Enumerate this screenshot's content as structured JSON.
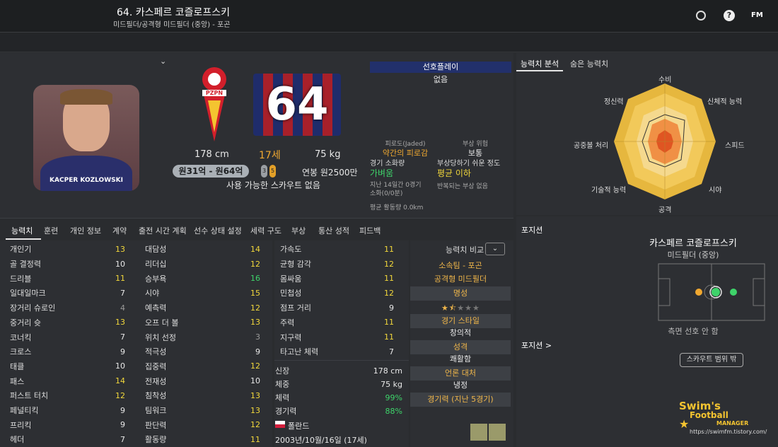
{
  "header": {
    "title": "64. 카스페르 코즐로프스키",
    "subtitle": "미드필더/공격형 미드필더 (중앙) - 포곤",
    "fm_label": "FM"
  },
  "player": {
    "photo_caption": "KACPER KOZLOWSKI",
    "crest_text": "PZPN",
    "shirt_number": "64",
    "height": "178 cm",
    "age": "17세",
    "weight": "75 kg",
    "value_range": "원31억 - 원64억",
    "ability_stars": [
      "3",
      "5"
    ],
    "wage": "연봉 원2500만",
    "scout_note": "사용 가능한 스카우트 없음"
  },
  "preferred": {
    "header": "선호플레이",
    "value": "없음"
  },
  "fitness": {
    "fatigue_label": "피로도(Jaded)",
    "fatigue_value": "약간의 피로감",
    "injury_label": "부상 위험",
    "injury_value": "보통",
    "match_load_label": "경기 소화량",
    "match_load_value": "가벼움",
    "proneness_label": "부상당하기 쉬운 정도",
    "proneness_value": "평균 이하",
    "recent_label": "지난 14일간 0경기 소화(0/0분)",
    "recurring_label": "반복되는 부상 없음",
    "avg_distance": "평균 활동량 0.0km"
  },
  "radar": {
    "tabs": [
      "능력치 분석",
      "숨은 능력치"
    ],
    "labels": [
      "수비",
      "신체적 능력",
      "스피드",
      "시야",
      "공격",
      "기술적 능력",
      "공중볼 처리",
      "정신력"
    ]
  },
  "tabs": [
    "능력치",
    "훈련",
    "개인 정보",
    "계약",
    "출전 시간 계획",
    "선수 상태 설정",
    "세력 구도",
    "부상",
    "통산 성적",
    "피드백"
  ],
  "technical": [
    {
      "name": "개인기",
      "value": "13",
      "c": "yellow"
    },
    {
      "name": "골 결정력",
      "value": "10",
      "c": "white"
    },
    {
      "name": "드리블",
      "value": "11",
      "c": "yellow"
    },
    {
      "name": "일대일마크",
      "value": "7",
      "c": "white"
    },
    {
      "name": "장거리 슈로인",
      "value": "4",
      "c": "grey"
    },
    {
      "name": "중거리 슛",
      "value": "13",
      "c": "yellow"
    },
    {
      "name": "코너킥",
      "value": "7",
      "c": "white"
    },
    {
      "name": "크로스",
      "value": "9",
      "c": "white"
    },
    {
      "name": "태클",
      "value": "10",
      "c": "white"
    },
    {
      "name": "패스",
      "value": "14",
      "c": "yellow"
    },
    {
      "name": "퍼스트 터치",
      "value": "12",
      "c": "yellow"
    },
    {
      "name": "페널티킥",
      "value": "9",
      "c": "white"
    },
    {
      "name": "프리킥",
      "value": "9",
      "c": "white"
    },
    {
      "name": "헤더",
      "value": "7",
      "c": "white"
    }
  ],
  "mental": [
    {
      "name": "대담성",
      "value": "14",
      "c": "yellow"
    },
    {
      "name": "리더십",
      "value": "12",
      "c": "yellow"
    },
    {
      "name": "승부욕",
      "value": "16",
      "c": "green"
    },
    {
      "name": "시야",
      "value": "15",
      "c": "yellow"
    },
    {
      "name": "예측력",
      "value": "12",
      "c": "yellow"
    },
    {
      "name": "오프 더 볼",
      "value": "13",
      "c": "yellow"
    },
    {
      "name": "위치 선정",
      "value": "3",
      "c": "grey"
    },
    {
      "name": "적극성",
      "value": "9",
      "c": "white"
    },
    {
      "name": "집중력",
      "value": "12",
      "c": "yellow"
    },
    {
      "name": "전재성",
      "value": "10",
      "c": "white"
    },
    {
      "name": "침착성",
      "value": "13",
      "c": "yellow"
    },
    {
      "name": "팀워크",
      "value": "13",
      "c": "yellow"
    },
    {
      "name": "판단력",
      "value": "12",
      "c": "yellow"
    },
    {
      "name": "활동량",
      "value": "11",
      "c": "yellow"
    }
  ],
  "physical": [
    {
      "name": "가속도",
      "value": "11",
      "c": "yellow"
    },
    {
      "name": "균형 감각",
      "value": "12",
      "c": "yellow"
    },
    {
      "name": "몸싸움",
      "value": "11",
      "c": "yellow"
    },
    {
      "name": "민첩성",
      "value": "12",
      "c": "yellow"
    },
    {
      "name": "점프 거리",
      "value": "9",
      "c": "white"
    },
    {
      "name": "주력",
      "value": "11",
      "c": "yellow"
    },
    {
      "name": "지구력",
      "value": "11",
      "c": "yellow"
    },
    {
      "name": "타고난 체력",
      "value": "7",
      "c": "white"
    }
  ],
  "info": [
    {
      "name": "신장",
      "value": "178 cm",
      "c": "white"
    },
    {
      "name": "체중",
      "value": "75 kg",
      "c": "white"
    },
    {
      "name": "체력",
      "value": "99%",
      "c": "green"
    },
    {
      "name": "경기력",
      "value": "88%",
      "c": "green"
    }
  ],
  "nationality": "폴란드",
  "birth": "2003년/10월/16일 (17세)",
  "compare": {
    "label": "능력치 비교",
    "team": "소속팀 - 포곤",
    "role": "공격형 미드필더",
    "reputation_header": "명성",
    "reputation_stars": 1.5,
    "style_header": "경기 스타일",
    "style_value": "창의적",
    "personality_header": "성격",
    "personality_value": "쾌활함",
    "media_header": "언론 대처",
    "media_value": "냉정",
    "form_header": "경기력 (지난 5경기)"
  },
  "position": {
    "label": "포지션",
    "name": "카스페르 코즐로프스키",
    "role": "미드필더 (중앙)",
    "side_note": "측면 선호 안 함",
    "pos_link": "포지션 >",
    "scout_button": "스카우트 범위 밖"
  },
  "watermark": {
    "line1": "Swim's",
    "line2": "Football",
    "line3": "MANAGER",
    "url": "https://swimfm.tistory.com/"
  }
}
